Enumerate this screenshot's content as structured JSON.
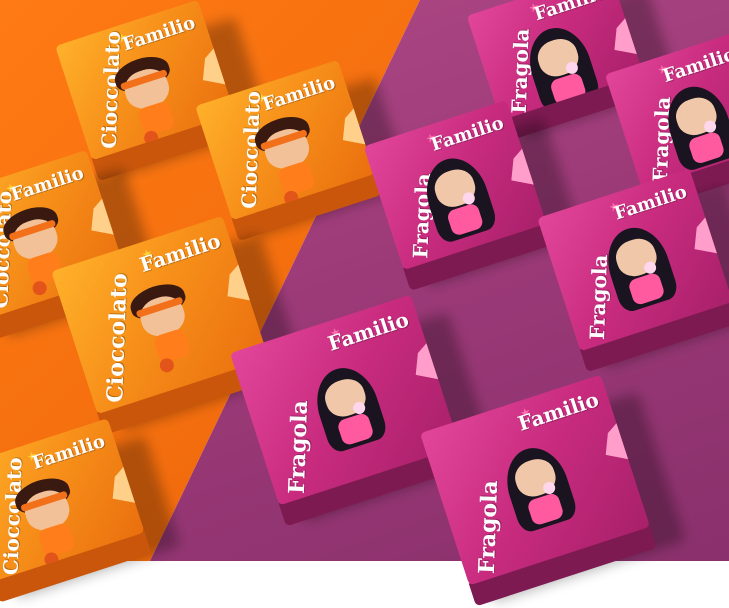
{
  "image": {
    "colors": {
      "orange_background": "#f06a0c",
      "pink_background": "#9c3a78",
      "orange_box": "#f7901a",
      "pink_box": "#c82b7e"
    },
    "boxes": [
      {
        "flavor": "Cioccolato",
        "brand": "Familio",
        "theme": "orange"
      },
      {
        "flavor": "Cioccolato",
        "brand": "Familio",
        "theme": "orange"
      },
      {
        "flavor": "Cioccolato",
        "brand": "Familio",
        "theme": "orange"
      },
      {
        "flavor": "Cioccolato",
        "brand": "Familio",
        "theme": "orange"
      },
      {
        "flavor": "Cioccolato",
        "brand": "Familio",
        "theme": "orange"
      },
      {
        "flavor": "Fragola",
        "brand": "Familio",
        "theme": "pink"
      },
      {
        "flavor": "Fragola",
        "brand": "Familio",
        "theme": "pink"
      },
      {
        "flavor": "Fragola",
        "brand": "Familio",
        "theme": "pink"
      },
      {
        "flavor": "Fragola",
        "brand": "Familio",
        "theme": "pink"
      },
      {
        "flavor": "Fragola",
        "brand": "Familio",
        "theme": "pink"
      },
      {
        "flavor": "Fragola",
        "brand": "Familio",
        "theme": "pink"
      }
    ]
  }
}
